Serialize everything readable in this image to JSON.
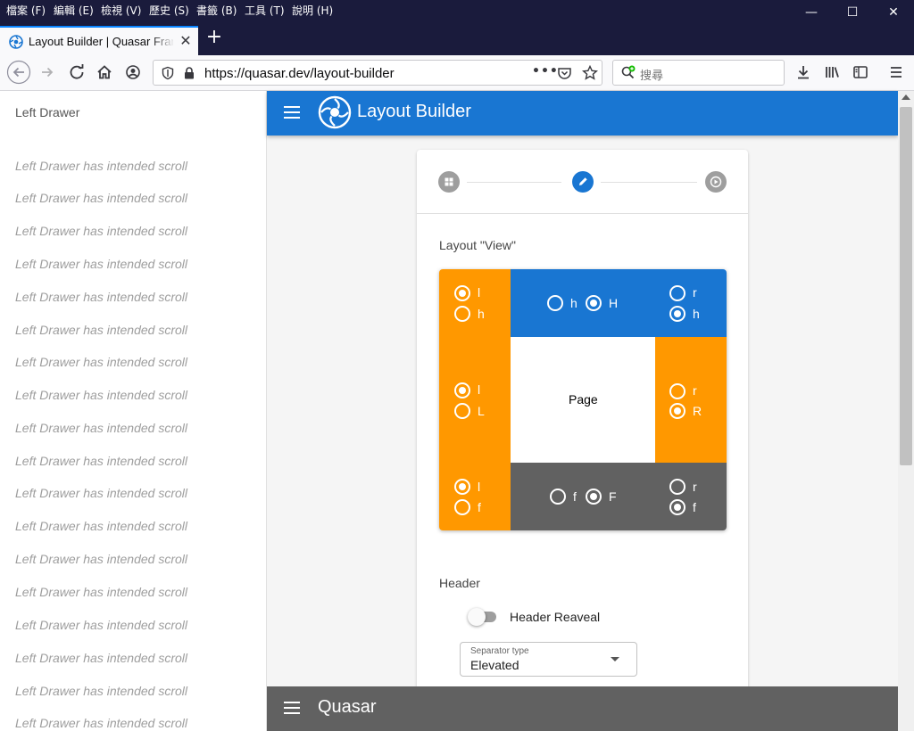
{
  "browser": {
    "menu": [
      "檔案 (F)",
      "編輯 (E)",
      "檢視 (V)",
      "歷史 (S)",
      "書籤 (B)",
      "工具 (T)",
      "說明 (H)"
    ],
    "tab_title": "Layout Builder | Quasar Framework",
    "url": "https://quasar.dev/layout-builder",
    "search_placeholder": "搜尋"
  },
  "drawer": {
    "title": "Left Drawer",
    "lines": [
      "Left Drawer has intended scroll",
      "Left Drawer has intended scroll",
      "Left Drawer has intended scroll",
      "Left Drawer has intended scroll",
      "Left Drawer has intended scroll",
      "Left Drawer has intended scroll",
      "Left Drawer has intended scroll",
      "Left Drawer has intended scroll",
      "Left Drawer has intended scroll",
      "Left Drawer has intended scroll",
      "Left Drawer has intended scroll",
      "Left Drawer has intended scroll",
      "Left Drawer has intended scroll",
      "Left Drawer has intended scroll",
      "Left Drawer has intended scroll",
      "Left Drawer has intended scroll",
      "Left Drawer has intended scroll",
      "Left Drawer has intended scroll"
    ]
  },
  "header": {
    "title": "Layout Builder"
  },
  "footer": {
    "title": "Quasar"
  },
  "layout_view": {
    "label": "Layout \"View\"",
    "top_left": [
      "l",
      "h"
    ],
    "top_center": [
      "h",
      "H"
    ],
    "top_right": [
      "r",
      "h"
    ],
    "middle_left": [
      "l",
      "L"
    ],
    "center": "Page",
    "middle_right": [
      "r",
      "R"
    ],
    "bottom_left": [
      "l",
      "f"
    ],
    "bottom_center": [
      "f",
      "F"
    ],
    "bottom_right": [
      "r",
      "f"
    ],
    "selected": {
      "top_left": "l",
      "top_center": "H",
      "top_right": "h",
      "middle_left": "l",
      "middle_right": "R",
      "bottom_left": "l",
      "bottom_center": "F",
      "bottom_right": "f"
    }
  },
  "header_section": {
    "label": "Header",
    "reveal_label": "Header Reaveal",
    "reveal_on": false,
    "separator_label": "Separator type",
    "separator_value": "Elevated"
  },
  "colors": {
    "primary": "#1976d2",
    "drawer_zone": "#ff9800",
    "footer_zone": "#616161",
    "window_chrome": "#1a1b3c"
  },
  "icons": {
    "stepper": [
      "grid-icon",
      "pencil-icon",
      "play-icon"
    ]
  }
}
